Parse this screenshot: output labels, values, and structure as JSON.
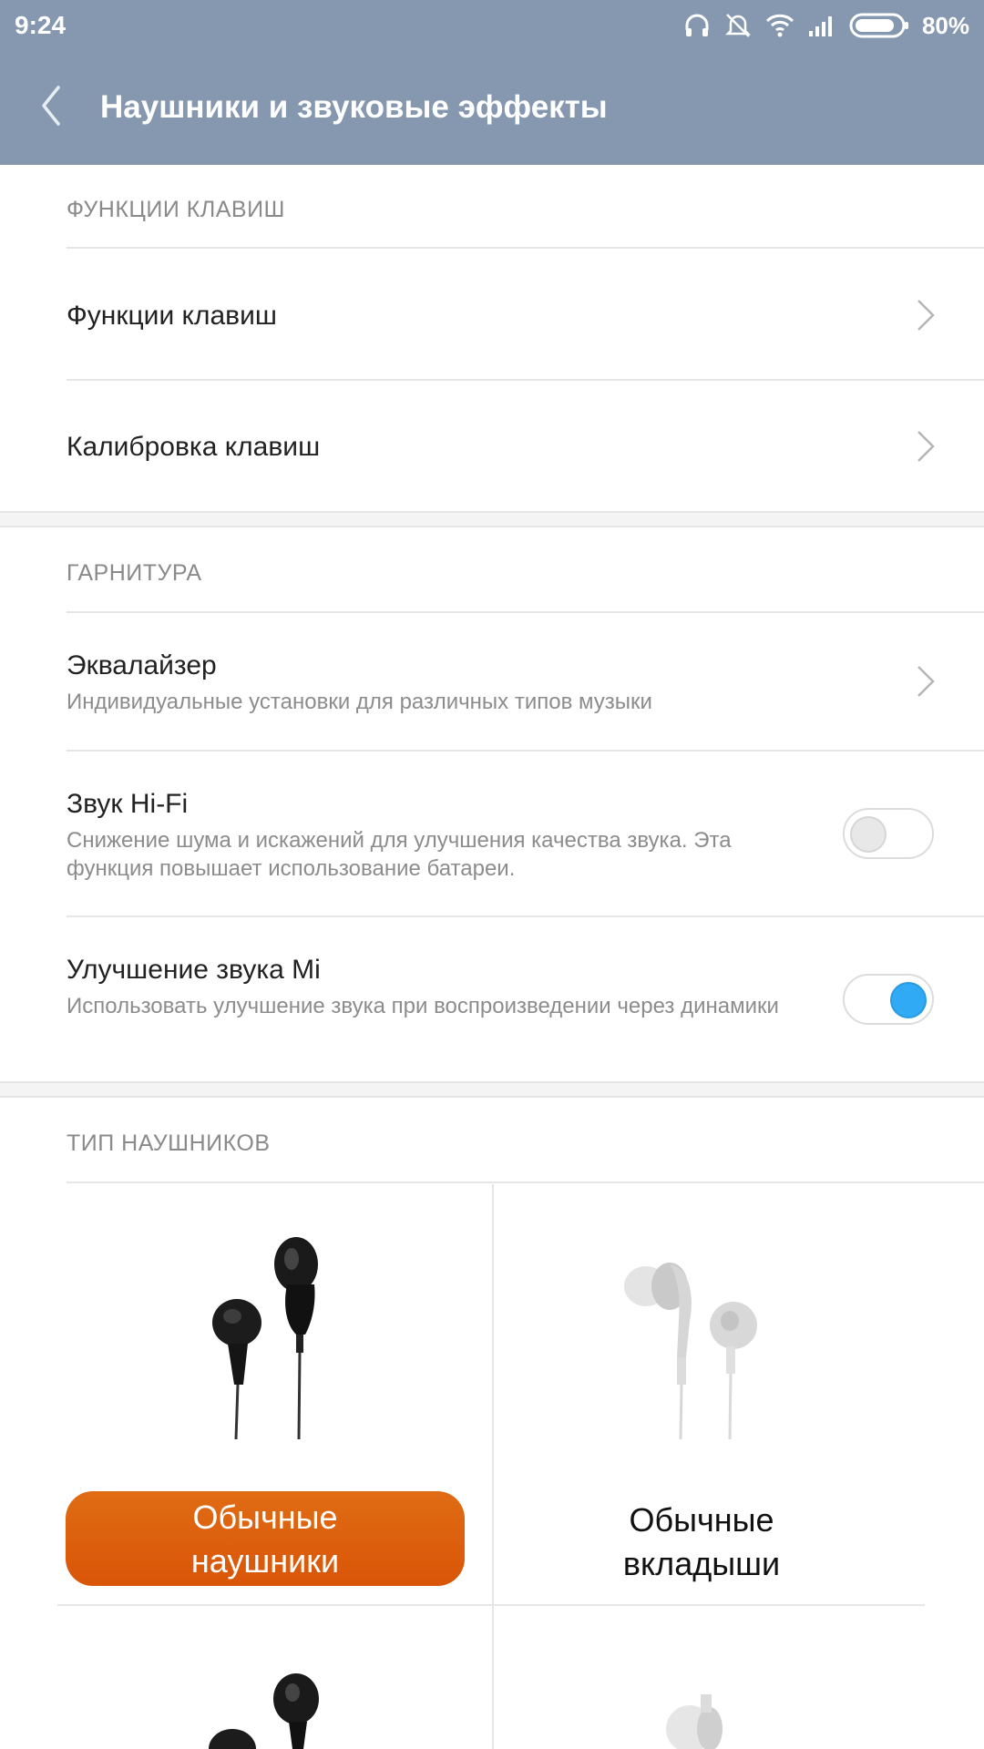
{
  "status_bar": {
    "time": "9:24",
    "battery": "80%"
  },
  "header": {
    "title": "Наушники и звуковые эффекты"
  },
  "sections": {
    "keys": {
      "heading": "ФУНКЦИИ КЛАВИШ",
      "items": [
        {
          "title": "Функции клавиш"
        },
        {
          "title": "Калибровка клавиш"
        }
      ]
    },
    "headset": {
      "heading": "ГАРНИТУРА",
      "equalizer": {
        "title": "Эквалайзер",
        "subtitle": "Индивидуальные установки для различных типов музыки"
      },
      "hifi": {
        "title": "Звук Hi-Fi",
        "subtitle": "Снижение шума и искажений для улучшения качества звука. Эта функция повышает использование батареи.",
        "enabled": false
      },
      "mi_sound": {
        "title": "Улучшение звука Mi",
        "subtitle": "Использовать улучшение звука при воспроизведении через динамики",
        "enabled": true
      }
    },
    "headphone_type": {
      "heading": "ТИП НАУШНИКОВ",
      "options": [
        {
          "label_line1": "Обычные",
          "label_line2": "наушники",
          "selected": true
        },
        {
          "label_line1": "Обычные",
          "label_line2": "вкладыши",
          "selected": false
        }
      ]
    }
  },
  "colors": {
    "header_bg": "#8598b0",
    "accent_blue": "#30aaf5",
    "selected_orange": "#e06c14"
  }
}
